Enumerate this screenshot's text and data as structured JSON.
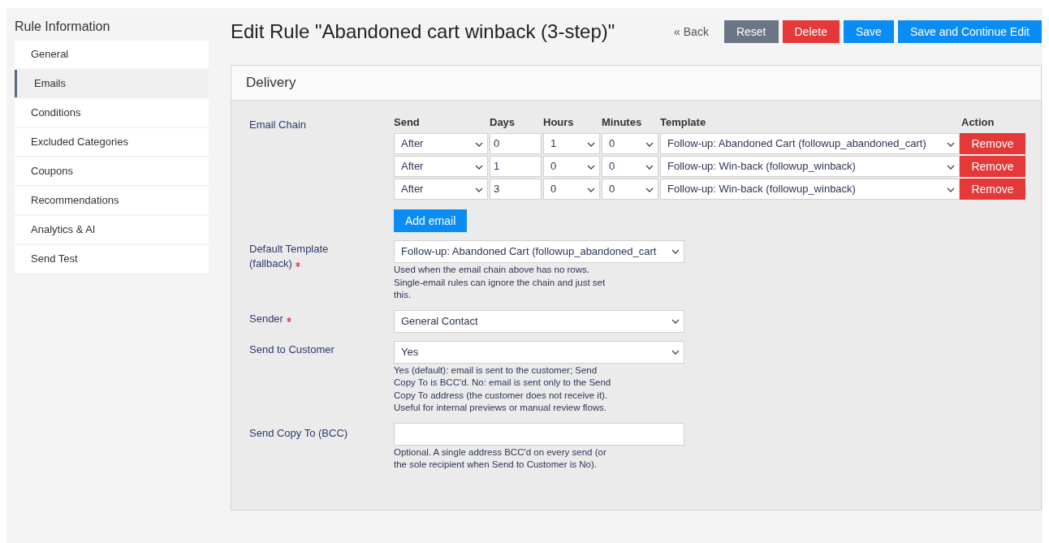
{
  "sidebar": {
    "title": "Rule Information",
    "items": [
      {
        "label": "General",
        "selected": false
      },
      {
        "label": "Emails",
        "selected": true
      },
      {
        "label": "Conditions",
        "selected": false
      },
      {
        "label": "Excluded Categories",
        "selected": false
      },
      {
        "label": "Coupons",
        "selected": false
      },
      {
        "label": "Recommendations",
        "selected": false
      },
      {
        "label": "Analytics & AI",
        "selected": false
      },
      {
        "label": "Send Test",
        "selected": false
      }
    ]
  },
  "header": {
    "title": "Edit Rule \"Abandoned cart winback (3-step)\"",
    "back_link": "« Back",
    "buttons": [
      {
        "label": "Reset",
        "kind": "neutral"
      },
      {
        "label": "Delete",
        "kind": "danger"
      },
      {
        "label": "Save",
        "kind": "primary"
      },
      {
        "label": "Save and Continue Edit",
        "kind": "primary"
      }
    ]
  },
  "panel": {
    "title": "Delivery",
    "email_chain": {
      "label": "Email Chain",
      "columns": [
        "Send",
        "Days",
        "Hours",
        "Minutes",
        "Template",
        "Action"
      ],
      "rows": [
        {
          "send": "After",
          "days": "0",
          "hours": "1",
          "minutes": "0",
          "template": "Follow-up: Abandoned Cart (followup_abandoned_cart)",
          "action": "Remove"
        },
        {
          "send": "After",
          "days": "1",
          "hours": "0",
          "minutes": "0",
          "template": "Follow-up: Win-back (followup_winback)",
          "action": "Remove"
        },
        {
          "send": "After",
          "days": "3",
          "hours": "0",
          "minutes": "0",
          "template": "Follow-up: Win-back (followup_winback)",
          "action": "Remove"
        }
      ],
      "add_button": "Add email"
    },
    "fields": [
      {
        "kind": "select",
        "label": "Default Template (fallback)",
        "required": true,
        "value": "Follow-up: Abandoned Cart (followup_abandoned_cart",
        "help": "Used when the email chain above has no rows. Single-email rules can ignore the chain and just set this."
      },
      {
        "kind": "select",
        "label": "Sender",
        "required": true,
        "value": "General Contact"
      },
      {
        "kind": "select",
        "label": "Send to Customer",
        "required": false,
        "value": "Yes",
        "help": "Yes (default): email is sent to the customer; Send Copy To is BCC'd. No: email is sent only to the Send Copy To address (the customer does not receive it). Useful for internal previews or manual review flows."
      },
      {
        "kind": "text",
        "label": "Send Copy To (BCC)",
        "required": false,
        "help": "Optional. A single address BCC'd on every send (or the sole recipient when Send to Customer is No)."
      }
    ]
  }
}
